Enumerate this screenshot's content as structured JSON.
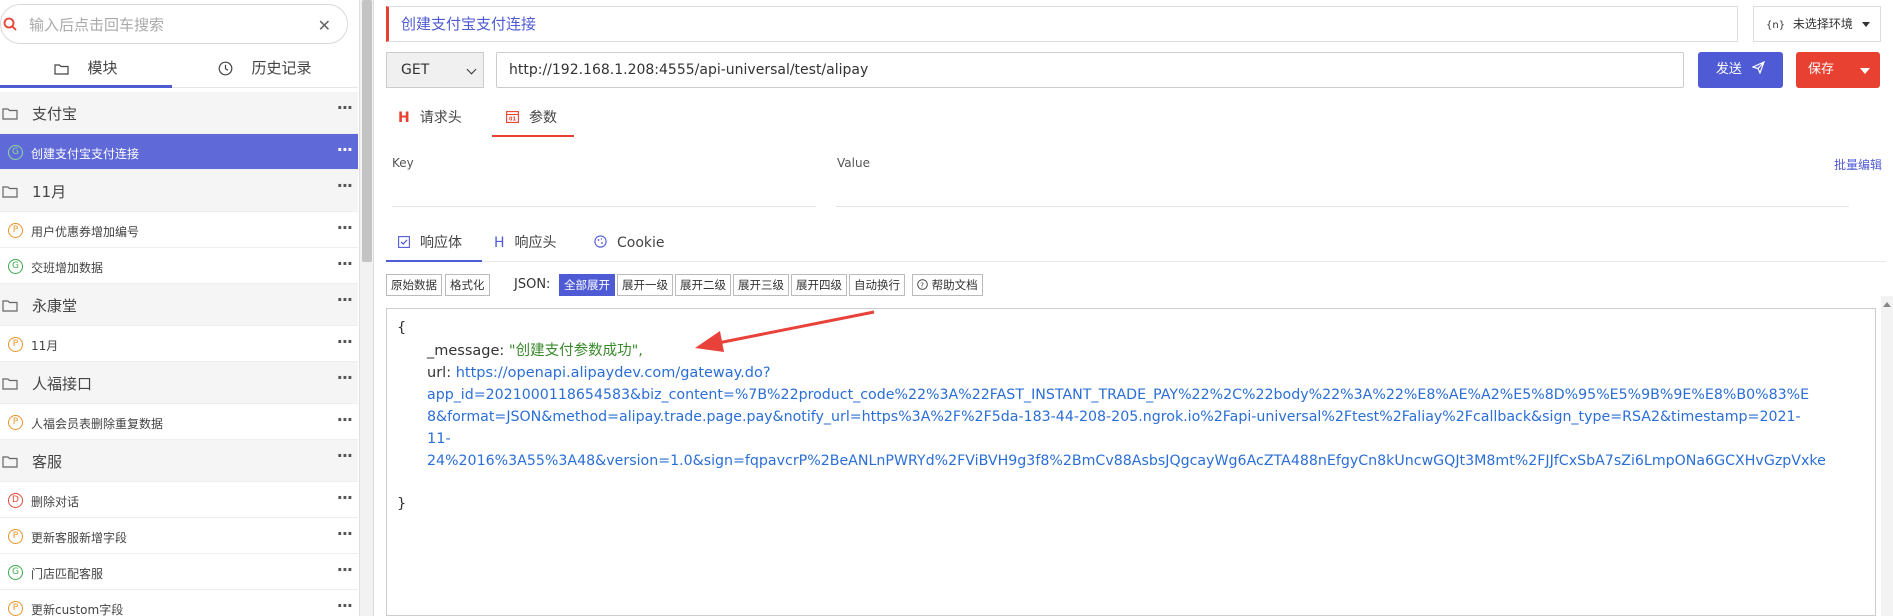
{
  "sidebar": {
    "search_placeholder": "输入后点击回车搜索",
    "tabs": [
      {
        "label": "模块"
      },
      {
        "label": "历史记录"
      }
    ],
    "items": [
      {
        "type": "folder",
        "label": "支付宝"
      },
      {
        "type": "api",
        "method": "G",
        "label": "创建支付宝支付连接",
        "selected": true
      },
      {
        "type": "folder",
        "label": "11月"
      },
      {
        "type": "api",
        "method": "P",
        "label": "用户优惠券增加编号"
      },
      {
        "type": "api",
        "method": "G",
        "label": "交班增加数据"
      },
      {
        "type": "folder",
        "label": "永康堂"
      },
      {
        "type": "api",
        "method": "P",
        "label": "11月"
      },
      {
        "type": "folder",
        "label": "人福接口"
      },
      {
        "type": "api",
        "method": "P",
        "label": "人福会员表删除重复数据"
      },
      {
        "type": "folder",
        "label": "客服"
      },
      {
        "type": "api",
        "method": "D",
        "label": "删除对话"
      },
      {
        "type": "api",
        "method": "P",
        "label": "更新客服新增字段"
      },
      {
        "type": "api",
        "method": "G",
        "label": "门店匹配客服"
      },
      {
        "type": "api",
        "method": "P",
        "label": "更新custom字段"
      }
    ],
    "more_glyph": "···"
  },
  "request": {
    "title": "创建支付宝支付连接",
    "environment": "未选择环境",
    "environment_icon": "{n}",
    "method": "GET",
    "url": "http://192.168.1.208:4555/api-universal/test/alipay",
    "send_label": "发送",
    "save_label": "保存",
    "tabs": [
      {
        "label": "请求头",
        "icon": "H"
      },
      {
        "label": "参数",
        "icon": "param-icon",
        "active": true
      }
    ],
    "params": {
      "key_header": "Key",
      "value_header": "Value",
      "bulk_edit": "批量编辑"
    }
  },
  "response": {
    "tabs": [
      {
        "label": "响应体",
        "active": true
      },
      {
        "label": "响应头"
      },
      {
        "label": "Cookie"
      }
    ],
    "toolbar": {
      "raw": "原始数据",
      "format": "格式化",
      "json_label": "JSON:",
      "expand_all": "全部展开",
      "expand_1": "展开一级",
      "expand_2": "展开二级",
      "expand_3": "展开三级",
      "expand_4": "展开四级",
      "auto_wrap": "自动换行",
      "help": "帮助文档"
    },
    "body": {
      "open_brace": "{",
      "message_key": "_message",
      "message_value": "\"创建支付参数成功\",",
      "url_key": "url",
      "url_line1": "https://openapi.alipaydev.com/gateway.do?",
      "url_line2": "app_id=2021000118654583&biz_content=%7B%22product_code%22%3A%22FAST_INSTANT_TRADE_PAY%22%2C%22body%22%3A%22%E8%AE%A2%E5%8D%95%E5%9B%9E%E8%B0%83%E",
      "url_line3": "8&format=JSON&method=alipay.trade.page.pay&notify_url=https%3A%2F%2F5da-183-44-208-205.ngrok.io%2Fapi-universal%2Ftest%2Faliay%2Fcallback&sign_type=RSA2&timestamp=2021-",
      "url_line4": "11-",
      "url_line5": "24%2016%3A55%3A48&version=1.0&sign=fqpavcrP%2BeANLnPWRYd%2FViBVH9g3f8%2BmCv88AsbsJQgcayWg6AcZTA488nEfgyCn8kUncwGQJt3M8mt%2FJJfCxSbA7sZi6LmpONa6GCXHvGzpVxke",
      "close_brace": "}"
    }
  },
  "colors": {
    "accent": "#4f5bd5",
    "danger": "#e84132",
    "string": "#3a8a2c",
    "link": "#2b6fd6"
  }
}
